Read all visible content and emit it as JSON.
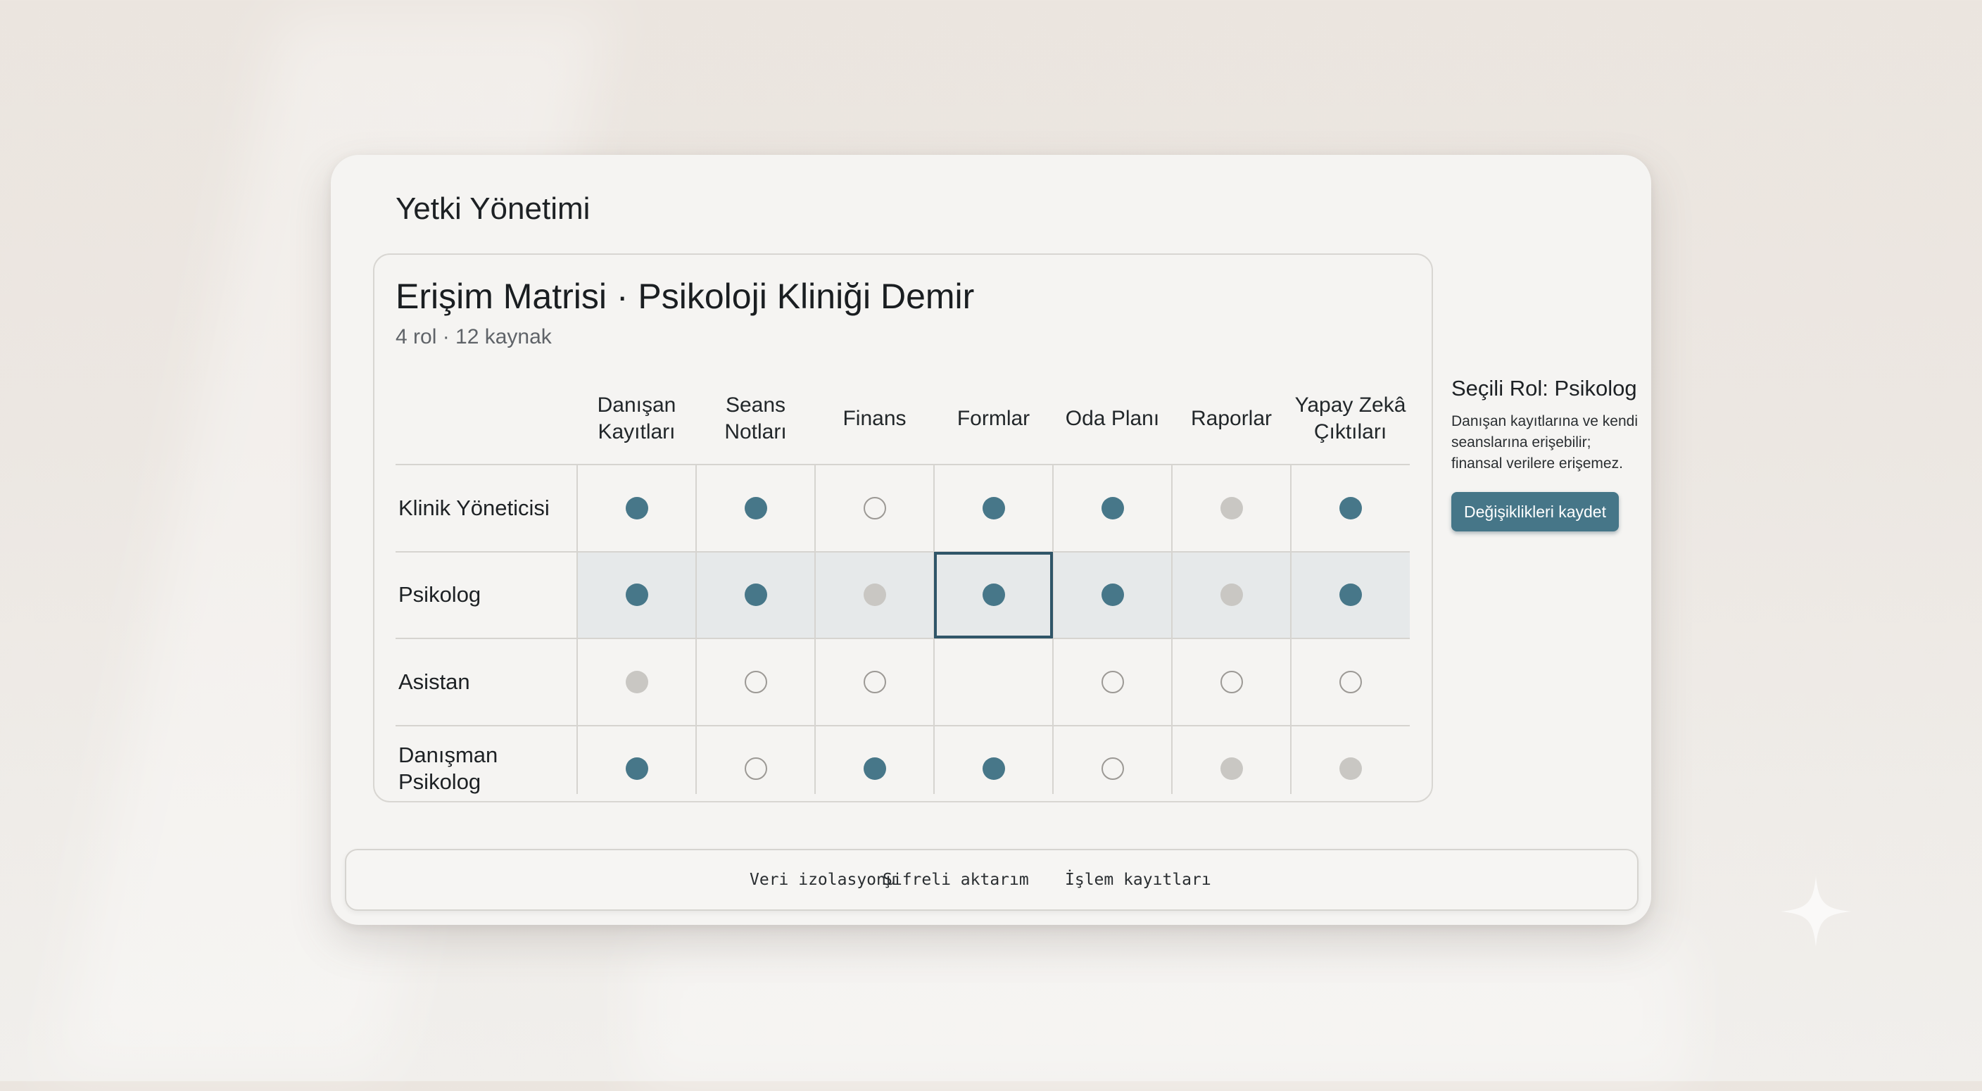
{
  "page": {
    "title": "Yetki Yönetimi"
  },
  "matrix": {
    "title": "Erişim Matrisi · Psikoloji Kliniği Demir",
    "subtitle": "4 rol · 12 kaynak",
    "columns": [
      "Danışan\nKayıtları",
      "Seans\nNotları",
      "Finans",
      "Formlar",
      "Oda Planı",
      "Raporlar",
      "Yapay Zekâ\nÇıktıları"
    ],
    "rows": [
      {
        "label": "Klinik Yöneticisi",
        "selected": false,
        "cells": [
          "full",
          "full",
          "none",
          "full",
          "full",
          "partial",
          "full"
        ]
      },
      {
        "label": "Psikolog",
        "selected": true,
        "cells": [
          "full",
          "full",
          "partial",
          "full",
          "full",
          "partial",
          "full"
        ]
      },
      {
        "label": "Asistan",
        "selected": false,
        "cells": [
          "partial",
          "none",
          "none",
          "",
          "none",
          "none",
          "none"
        ]
      },
      {
        "label": "Danışman\nPsikolog",
        "selected": false,
        "cells": [
          "full",
          "none",
          "full",
          "full",
          "none",
          "partial",
          "partial"
        ]
      }
    ],
    "focused_cell": {
      "row": 1,
      "col": 3
    }
  },
  "sidebar": {
    "title": "Seçili Rol: Psikolog",
    "description": "Danışan kayıtlarına ve kendi seanslarına erişebilir; finansal verilere erişemez.",
    "save_button": "Değişiklikleri kaydet"
  },
  "footer": {
    "items": [
      "Veri izolasyonu",
      "Şifreli aktarım",
      "İşlem kayıtları"
    ]
  },
  "colors": {
    "accent": "#467688",
    "dot_full": "#477789",
    "dot_partial": "#c9c7c3",
    "selected_row": "#e6e9ea"
  },
  "icons": {
    "decor": "sparkle-icon"
  }
}
